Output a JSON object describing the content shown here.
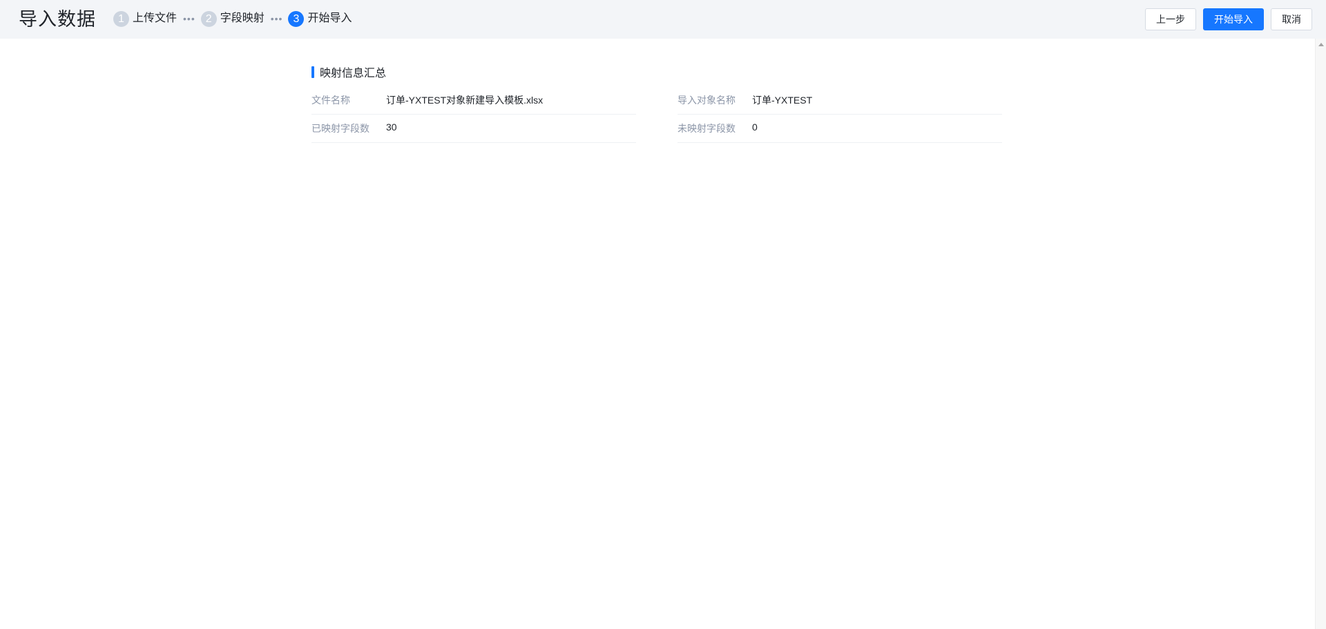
{
  "header": {
    "title": "导入数据",
    "steps": [
      {
        "num": "1",
        "label": "上传文件"
      },
      {
        "num": "2",
        "label": "字段映射"
      },
      {
        "num": "3",
        "label": "开始导入"
      }
    ],
    "step_separator": "•••",
    "active_step": 3,
    "actions": {
      "prev_label": "上一步",
      "start_label": "开始导入",
      "cancel_label": "取消"
    }
  },
  "summary": {
    "title": "映射信息汇总",
    "rows": [
      {
        "label": "文件名称",
        "value": "订单-YXTEST对象新建导入模板.xlsx"
      },
      {
        "label": "导入对象名称",
        "value": "订单-YXTEST"
      },
      {
        "label": "已映射字段数",
        "value": "30"
      },
      {
        "label": "未映射字段数",
        "value": "0"
      }
    ]
  },
  "colors": {
    "accent": "#1677ff",
    "header_bg": "#f3f5f8",
    "step_inactive": "#ccd4df",
    "label_gray": "#8c96a8"
  },
  "icons": [
    "scroll-up-arrow-icon"
  ]
}
